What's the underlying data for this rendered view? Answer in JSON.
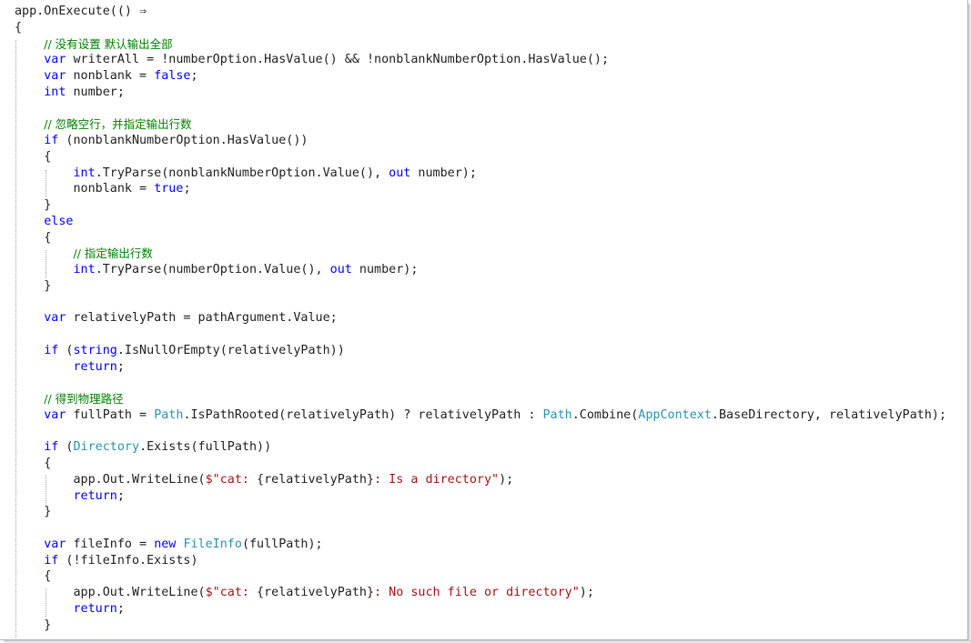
{
  "code_lines": [
    {
      "segments": [
        {
          "t": "app.OnExecute(() ⇒",
          "c": "plain"
        }
      ]
    },
    {
      "segments": [
        {
          "t": "{",
          "c": "plain"
        }
      ]
    },
    {
      "segments": [
        {
          "t": "    ",
          "c": "plain"
        },
        {
          "t": "// 没有设置 默认输出全部",
          "c": "cm"
        }
      ]
    },
    {
      "segments": [
        {
          "t": "    ",
          "c": "plain"
        },
        {
          "t": "var",
          "c": "kw"
        },
        {
          "t": " writerAll = !numberOption.HasValue() ",
          "c": "plain"
        },
        {
          "t": "&&",
          "c": "plain"
        },
        {
          "t": " !nonblankNumberOption.HasValue();",
          "c": "plain"
        }
      ]
    },
    {
      "segments": [
        {
          "t": "    ",
          "c": "plain"
        },
        {
          "t": "var",
          "c": "kw"
        },
        {
          "t": " nonblank = ",
          "c": "plain"
        },
        {
          "t": "false",
          "c": "kw"
        },
        {
          "t": ";",
          "c": "plain"
        }
      ]
    },
    {
      "segments": [
        {
          "t": "    ",
          "c": "plain"
        },
        {
          "t": "int",
          "c": "kw"
        },
        {
          "t": " number;",
          "c": "plain"
        }
      ]
    },
    {
      "segments": []
    },
    {
      "segments": [
        {
          "t": "    ",
          "c": "plain"
        },
        {
          "t": "// 忽略空行，并指定输出行数",
          "c": "cm"
        }
      ]
    },
    {
      "segments": [
        {
          "t": "    ",
          "c": "plain"
        },
        {
          "t": "if",
          "c": "kw"
        },
        {
          "t": " (nonblankNumberOption.HasValue())",
          "c": "plain"
        }
      ]
    },
    {
      "segments": [
        {
          "t": "    {",
          "c": "plain"
        }
      ]
    },
    {
      "segments": [
        {
          "t": "        ",
          "c": "plain"
        },
        {
          "t": "int",
          "c": "kw"
        },
        {
          "t": ".TryParse(nonblankNumberOption.Value(), ",
          "c": "plain"
        },
        {
          "t": "out",
          "c": "kw"
        },
        {
          "t": " number);",
          "c": "plain"
        }
      ]
    },
    {
      "segments": [
        {
          "t": "        nonblank = ",
          "c": "plain"
        },
        {
          "t": "true",
          "c": "kw"
        },
        {
          "t": ";",
          "c": "plain"
        }
      ]
    },
    {
      "segments": [
        {
          "t": "    }",
          "c": "plain"
        }
      ]
    },
    {
      "segments": [
        {
          "t": "    ",
          "c": "plain"
        },
        {
          "t": "else",
          "c": "kw"
        }
      ]
    },
    {
      "segments": [
        {
          "t": "    {",
          "c": "plain"
        }
      ]
    },
    {
      "segments": [
        {
          "t": "        ",
          "c": "plain"
        },
        {
          "t": "// 指定输出行数",
          "c": "cm"
        }
      ]
    },
    {
      "segments": [
        {
          "t": "        ",
          "c": "plain"
        },
        {
          "t": "int",
          "c": "kw"
        },
        {
          "t": ".TryParse(numberOption.Value(), ",
          "c": "plain"
        },
        {
          "t": "out",
          "c": "kw"
        },
        {
          "t": " number);",
          "c": "plain"
        }
      ]
    },
    {
      "segments": [
        {
          "t": "    }",
          "c": "plain"
        }
      ]
    },
    {
      "segments": []
    },
    {
      "segments": [
        {
          "t": "    ",
          "c": "plain"
        },
        {
          "t": "var",
          "c": "kw"
        },
        {
          "t": " relativelyPath = pathArgument.Value;",
          "c": "plain"
        }
      ]
    },
    {
      "segments": []
    },
    {
      "segments": [
        {
          "t": "    ",
          "c": "plain"
        },
        {
          "t": "if",
          "c": "kw"
        },
        {
          "t": " (",
          "c": "plain"
        },
        {
          "t": "string",
          "c": "kw"
        },
        {
          "t": ".IsNullOrEmpty(relativelyPath))",
          "c": "plain"
        }
      ]
    },
    {
      "segments": [
        {
          "t": "        ",
          "c": "plain"
        },
        {
          "t": "return",
          "c": "kw"
        },
        {
          "t": ";",
          "c": "plain"
        }
      ]
    },
    {
      "segments": []
    },
    {
      "segments": [
        {
          "t": "    ",
          "c": "plain"
        },
        {
          "t": "// 得到物理路径",
          "c": "cm"
        }
      ]
    },
    {
      "segments": [
        {
          "t": "    ",
          "c": "plain"
        },
        {
          "t": "var",
          "c": "kw"
        },
        {
          "t": " fullPath = ",
          "c": "plain"
        },
        {
          "t": "Path",
          "c": "ty"
        },
        {
          "t": ".IsPathRooted(relativelyPath) ? relativelyPath : ",
          "c": "plain"
        },
        {
          "t": "Path",
          "c": "ty"
        },
        {
          "t": ".Combine(",
          "c": "plain"
        },
        {
          "t": "AppContext",
          "c": "ty"
        },
        {
          "t": ".BaseDirectory, relativelyPath);",
          "c": "plain"
        }
      ]
    },
    {
      "segments": []
    },
    {
      "segments": [
        {
          "t": "    ",
          "c": "plain"
        },
        {
          "t": "if",
          "c": "kw"
        },
        {
          "t": " (",
          "c": "plain"
        },
        {
          "t": "Directory",
          "c": "ty"
        },
        {
          "t": ".Exists(fullPath))",
          "c": "plain"
        }
      ]
    },
    {
      "segments": [
        {
          "t": "    {",
          "c": "plain"
        }
      ]
    },
    {
      "segments": [
        {
          "t": "        app.Out.WriteLine(",
          "c": "plain"
        },
        {
          "t": "$\"cat: ",
          "c": "str"
        },
        {
          "t": "{relativelyPath}",
          "c": "plain"
        },
        {
          "t": ": Is a directory\"",
          "c": "str"
        },
        {
          "t": ");",
          "c": "plain"
        }
      ]
    },
    {
      "segments": [
        {
          "t": "        ",
          "c": "plain"
        },
        {
          "t": "return",
          "c": "kw"
        },
        {
          "t": ";",
          "c": "plain"
        }
      ]
    },
    {
      "segments": [
        {
          "t": "    }",
          "c": "plain"
        }
      ]
    },
    {
      "segments": []
    },
    {
      "segments": [
        {
          "t": "    ",
          "c": "plain"
        },
        {
          "t": "var",
          "c": "kw"
        },
        {
          "t": " fileInfo = ",
          "c": "plain"
        },
        {
          "t": "new",
          "c": "kw"
        },
        {
          "t": " ",
          "c": "plain"
        },
        {
          "t": "FileInfo",
          "c": "ty"
        },
        {
          "t": "(fullPath);",
          "c": "plain"
        }
      ]
    },
    {
      "segments": [
        {
          "t": "    ",
          "c": "plain"
        },
        {
          "t": "if",
          "c": "kw"
        },
        {
          "t": " (!fileInfo.Exists)",
          "c": "plain"
        }
      ]
    },
    {
      "segments": [
        {
          "t": "    {",
          "c": "plain"
        }
      ]
    },
    {
      "segments": [
        {
          "t": "        app.Out.WriteLine(",
          "c": "plain"
        },
        {
          "t": "$\"cat: ",
          "c": "str"
        },
        {
          "t": "{relativelyPath}",
          "c": "plain"
        },
        {
          "t": ": No such file or directory\"",
          "c": "str"
        },
        {
          "t": ");",
          "c": "plain"
        }
      ]
    },
    {
      "segments": [
        {
          "t": "        ",
          "c": "plain"
        },
        {
          "t": "return",
          "c": "kw"
        },
        {
          "t": ";",
          "c": "plain"
        }
      ]
    },
    {
      "segments": [
        {
          "t": "    }",
          "c": "plain"
        }
      ]
    }
  ],
  "colors": {
    "keyword": "#0000ff",
    "type": "#2b91af",
    "string": "#a31515",
    "comment": "#008000",
    "text": "#1e1e1e",
    "background": "#ffffff"
  }
}
